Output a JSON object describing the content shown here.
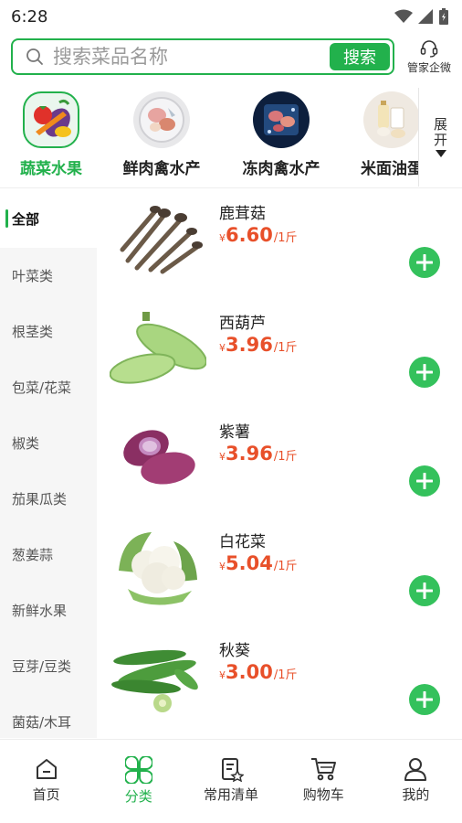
{
  "status": {
    "time": "6:28"
  },
  "search": {
    "placeholder": "搜索菜品名称",
    "button_label": "搜索"
  },
  "help": {
    "label": "管家企微"
  },
  "categories": [
    {
      "label": "蔬菜水果",
      "icon": "vegetables-fruits-image",
      "active": true
    },
    {
      "label": "鲜肉禽水产",
      "icon": "fresh-meat-image",
      "active": false
    },
    {
      "label": "冻肉禽水产",
      "icon": "frozen-meat-image",
      "active": false
    },
    {
      "label": "米面油蛋",
      "icon": "rice-flour-oil-egg-image",
      "active": false
    }
  ],
  "expand": {
    "label": "展开"
  },
  "sidebar": {
    "items": [
      {
        "label": "全部",
        "active": true
      },
      {
        "label": "叶菜类"
      },
      {
        "label": "根茎类"
      },
      {
        "label": "包菜/花菜"
      },
      {
        "label": "椒类"
      },
      {
        "label": "茄果瓜类"
      },
      {
        "label": "葱姜蒜"
      },
      {
        "label": "新鲜水果"
      },
      {
        "label": "豆芽/豆类"
      },
      {
        "label": "菌菇/木耳"
      }
    ]
  },
  "products": [
    {
      "name": "鹿茸菇",
      "currency": "¥",
      "price": "6.60",
      "unit": "/1斤",
      "image": "mushroom-image"
    },
    {
      "name": "西葫芦",
      "currency": "¥",
      "price": "3.96",
      "unit": "/1斤",
      "image": "zucchini-image"
    },
    {
      "name": "紫薯",
      "currency": "¥",
      "price": "3.96",
      "unit": "/1斤",
      "image": "purple-sweet-potato-image"
    },
    {
      "name": "白花菜",
      "currency": "¥",
      "price": "5.04",
      "unit": "/1斤",
      "image": "cauliflower-image"
    },
    {
      "name": "秋葵",
      "currency": "¥",
      "price": "3.00",
      "unit": "/1斤",
      "image": "okra-image"
    }
  ],
  "nav": {
    "items": [
      {
        "label": "首页",
        "icon": "home-icon"
      },
      {
        "label": "分类",
        "icon": "category-icon",
        "active": true
      },
      {
        "label": "常用清单",
        "icon": "list-icon"
      },
      {
        "label": "购物车",
        "icon": "cart-icon"
      },
      {
        "label": "我的",
        "icon": "profile-icon"
      }
    ]
  },
  "colors": {
    "accent": "#22b14c",
    "price": "#e8502a"
  }
}
